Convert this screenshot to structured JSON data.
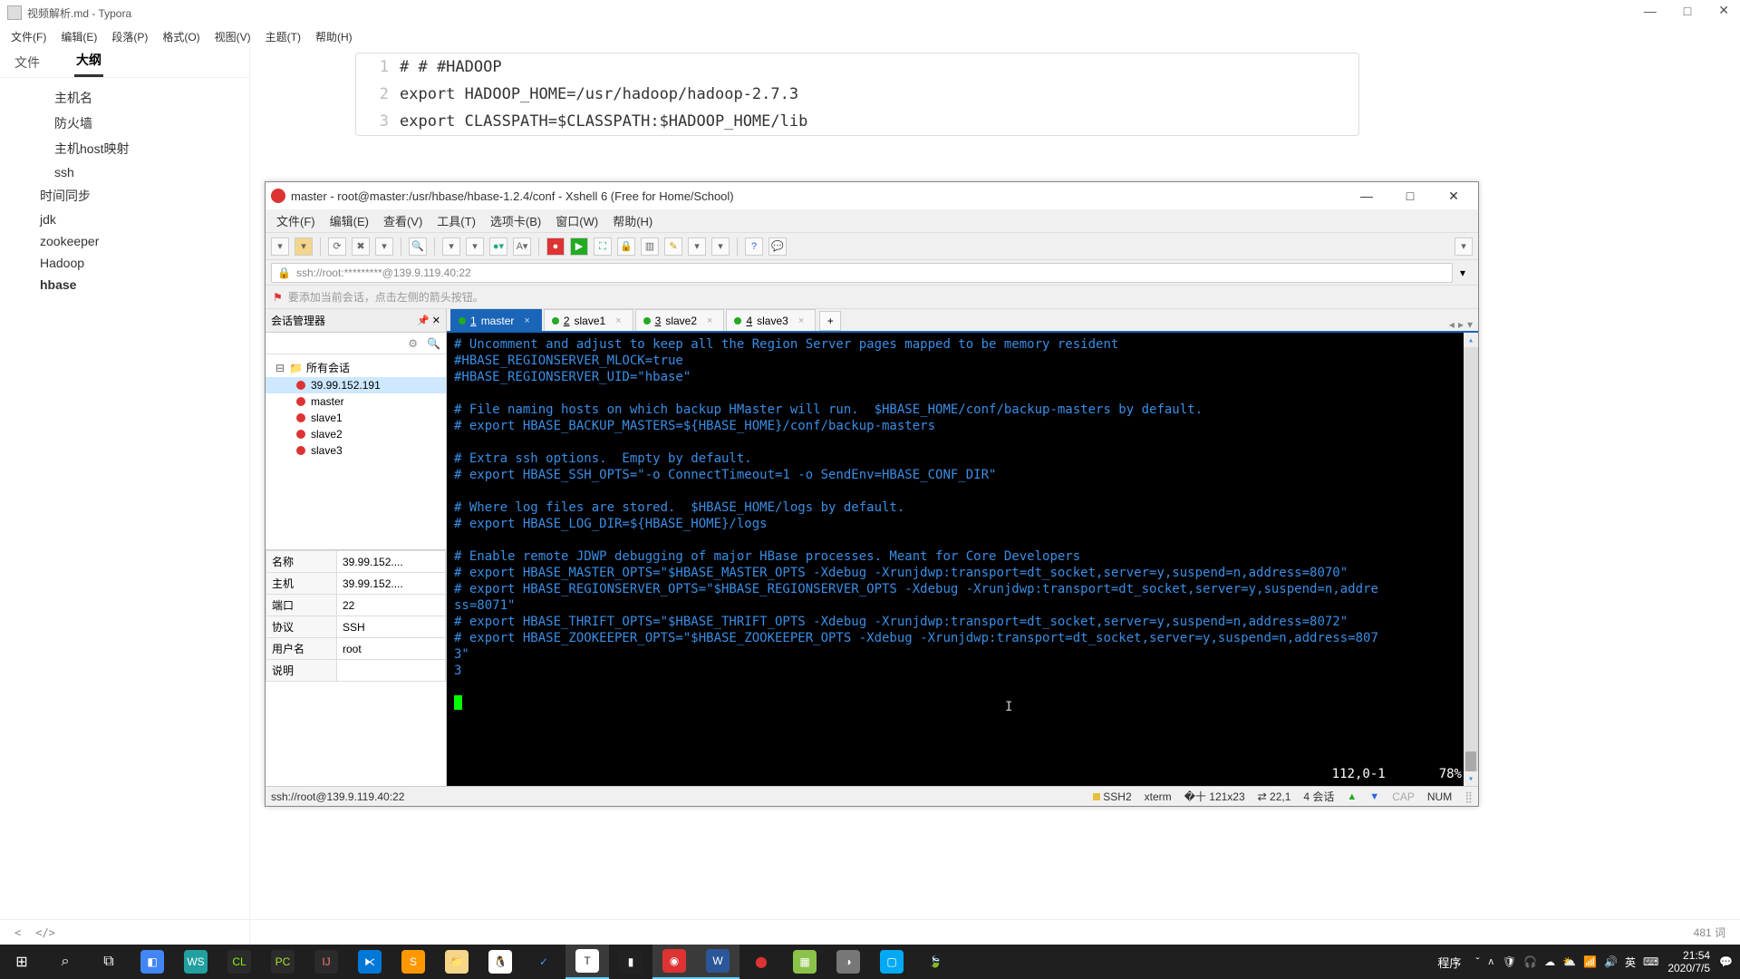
{
  "typora": {
    "title": "视频解析.md - Typora",
    "menu": [
      "文件(F)",
      "编辑(E)",
      "段落(P)",
      "格式(O)",
      "视图(V)",
      "主题(T)",
      "帮助(H)"
    ],
    "sidebar_tabs": {
      "file": "文件",
      "outline": "大纲"
    },
    "outline": [
      {
        "t": "主机名",
        "l": 1
      },
      {
        "t": "防火墙",
        "l": 1
      },
      {
        "t": "主机host映射",
        "l": 1
      },
      {
        "t": "ssh",
        "l": 1
      },
      {
        "t": "时间同步",
        "l": 0
      },
      {
        "t": "jdk",
        "l": 0
      },
      {
        "t": "zookeeper",
        "l": 0
      },
      {
        "t": "Hadoop",
        "l": 0
      },
      {
        "t": "hbase",
        "l": 0,
        "b": true
      }
    ],
    "code": [
      "#  #  #HADOOP",
      "export HADOOP_HOME=/usr/hadoop/hadoop-2.7.3",
      "export CLASSPATH=$CLASSPATH:$HADOOP_HOME/lib"
    ],
    "footer_wordcount": "481 词"
  },
  "xshell": {
    "title": "master - root@master:/usr/hbase/hbase-1.2.4/conf - Xshell 6 (Free for Home/School)",
    "menu": [
      "文件(F)",
      "编辑(E)",
      "查看(V)",
      "工具(T)",
      "选项卡(B)",
      "窗口(W)",
      "帮助(H)"
    ],
    "address": "ssh://root:*********@139.9.119.40:22",
    "tip": "要添加当前会话，点击左侧的箭头按钮。",
    "session_mgr": "会话管理器",
    "tree_root": "所有会话",
    "tree_nodes": [
      "39.99.152.191",
      "master",
      "slave1",
      "slave2",
      "slave3"
    ],
    "props": [
      [
        "名称",
        "39.99.152...."
      ],
      [
        "主机",
        "39.99.152...."
      ],
      [
        "端口",
        "22"
      ],
      [
        "协议",
        "SSH"
      ],
      [
        "用户名",
        "root"
      ],
      [
        "说明",
        ""
      ]
    ],
    "tabs": [
      {
        "n": "1",
        "label": "master",
        "active": true
      },
      {
        "n": "2",
        "label": "slave1"
      },
      {
        "n": "3",
        "label": "slave2"
      },
      {
        "n": "4",
        "label": "slave3"
      }
    ],
    "term_lines": [
      "# Uncomment and adjust to keep all the Region Server pages mapped to be memory resident",
      "#HBASE_REGIONSERVER_MLOCK=true",
      "#HBASE_REGIONSERVER_UID=\"hbase\"",
      "",
      "# File naming hosts on which backup HMaster will run.  $HBASE_HOME/conf/backup-masters by default.",
      "# export HBASE_BACKUP_MASTERS=${HBASE_HOME}/conf/backup-masters",
      "",
      "# Extra ssh options.  Empty by default.",
      "# export HBASE_SSH_OPTS=\"-o ConnectTimeout=1 -o SendEnv=HBASE_CONF_DIR\"",
      "",
      "# Where log files are stored.  $HBASE_HOME/logs by default.",
      "# export HBASE_LOG_DIR=${HBASE_HOME}/logs",
      "",
      "# Enable remote JDWP debugging of major HBase processes. Meant for Core Developers",
      "# export HBASE_MASTER_OPTS=\"$HBASE_MASTER_OPTS -Xdebug -Xrunjdwp:transport=dt_socket,server=y,suspend=n,address=8070\"",
      "# export HBASE_REGIONSERVER_OPTS=\"$HBASE_REGIONSERVER_OPTS -Xdebug -Xrunjdwp:transport=dt_socket,server=y,suspend=n,addre",
      "ss=8071\"",
      "# export HBASE_THRIFT_OPTS=\"$HBASE_THRIFT_OPTS -Xdebug -Xrunjdwp:transport=dt_socket,server=y,suspend=n,address=8072\"",
      "# export HBASE_ZOOKEEPER_OPTS=\"$HBASE_ZOOKEEPER_OPTS -Xdebug -Xrunjdwp:transport=dt_socket,server=y,suspend=n,address=807",
      "3\"",
      "3"
    ],
    "pos": "112,0-1",
    "pct": "78%",
    "status": {
      "path": "ssh://root@139.9.119.40:22",
      "proto": "SSH2",
      "term": "xterm",
      "size": "121x23",
      "cur": "22,1",
      "sessions": "4 会话",
      "cap": "CAP",
      "num": "NUM"
    }
  },
  "taskbar": {
    "program_label": "程序",
    "ime": "英",
    "time": "21:54",
    "date": "2020/7/5"
  }
}
